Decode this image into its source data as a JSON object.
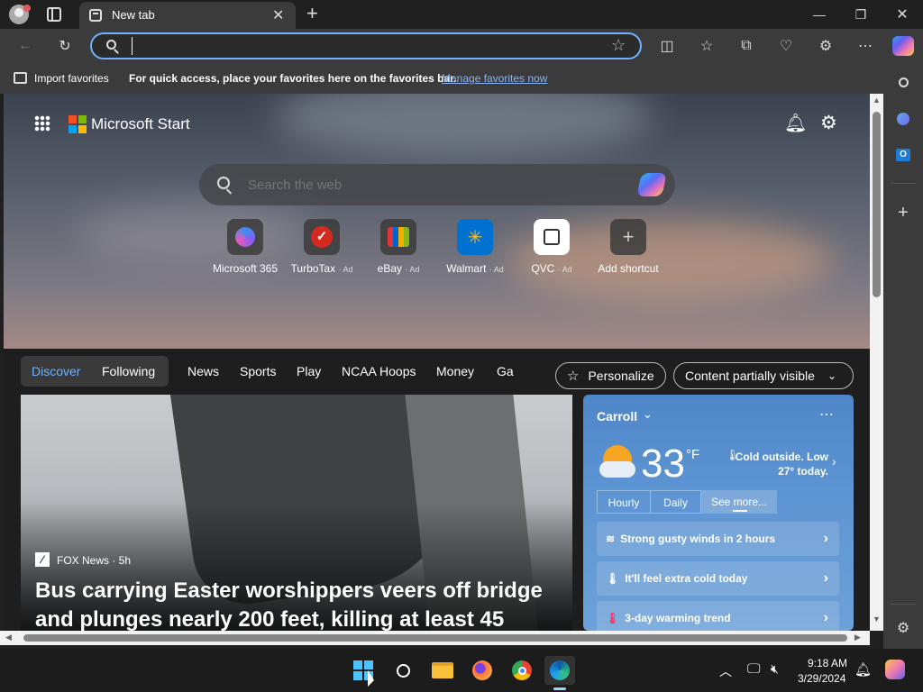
{
  "browser": {
    "tab_title": "New tab",
    "address_value": "",
    "favorites_bar": {
      "import_label": "Import favorites",
      "hint_text": "For quick access, place your favorites here on the favorites bar.",
      "manage_link": "Manage favorites now"
    }
  },
  "page": {
    "brand": "Microsoft Start",
    "search_placeholder": "Search the web",
    "shortcuts": [
      {
        "label": "Microsoft 365",
        "ad": ""
      },
      {
        "label": "TurboTax",
        "ad": "· Ad"
      },
      {
        "label": "eBay",
        "ad": "· Ad"
      },
      {
        "label": "Walmart",
        "ad": "· Ad"
      },
      {
        "label": "QVC",
        "ad": "· Ad"
      },
      {
        "label": "Add shortcut",
        "ad": ""
      }
    ],
    "feed_tabs": [
      "Discover",
      "Following",
      "News",
      "Sports",
      "Play",
      "NCAA Hoops",
      "Money",
      "Ga"
    ],
    "personalize_label": "Personalize",
    "content_visibility_label": "Content partially visible",
    "news": {
      "source": "FOX News · 5h",
      "headline": "Bus carrying Easter worshippers veers off bridge and plunges nearly 200 feet, killing at least 45"
    },
    "weather": {
      "location": "Carroll",
      "temperature": "33",
      "unit": "°F",
      "note": "Cold outside. Low 27° today.",
      "tabs": [
        "Hourly",
        "Daily",
        "See more..."
      ],
      "alerts": [
        "Strong gusty winds in 2 hours",
        "It'll feel extra cold today",
        "3-day warming trend"
      ]
    }
  },
  "taskbar": {
    "time": "9:18 AM",
    "date": "3/29/2024"
  },
  "colors": {
    "accent": "#6fb2ff",
    "link": "#8ab4f8",
    "weather_bg": "#5d94d2"
  }
}
